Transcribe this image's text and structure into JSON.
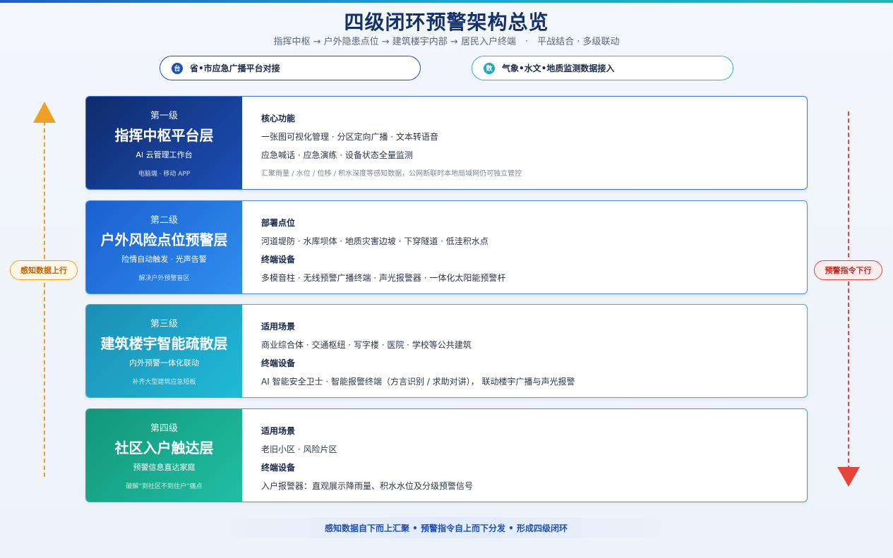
{
  "header": {
    "title": "四级闭环预警架构总览",
    "subtitle": "指挥中枢 → 户外隐患点位 → 建筑楼宇内部 → 居民入户终端　·　平战结合 · 多级联动"
  },
  "pills": {
    "left": {
      "badge": "台",
      "label": "省•市应急广播平台对接"
    },
    "right": {
      "badge": "数",
      "label": "气象•水文•地质监测数据接入"
    }
  },
  "side": {
    "up_label": "感知数据上行",
    "down_label": "预警指令下行"
  },
  "levels": [
    {
      "num": "第一级",
      "name": "指挥中枢平台层",
      "desc": "AI 云管理工作台",
      "note": "电脑端 · 移动 APP",
      "s1_title": "核心功能",
      "s1_line1": "一张图可视化管理 · 分区定向广播 · 文本转语音",
      "s1_line2": "应急喊话 · 应急演练 · 设备状态全量监测",
      "note_line": "汇聚雨量 / 水位 / 位移 / 积水深度等感知数据，公网断联时本地局域网仍可独立管控"
    },
    {
      "num": "第二级",
      "name": "户外风险点位预警层",
      "desc": "险情自动触发 · 光声告警",
      "note": "解决户外预警盲区",
      "s1_title": "部署点位",
      "s1_line1": "河道堤防 · 水库坝体 · 地质灾害边坡 · 下穿隧道 · 低洼积水点",
      "s2_title": "终端设备",
      "s2_line1": "多模音柱 · 无线预警广播终端 · 声光报警器 · 一体化太阳能预警杆"
    },
    {
      "num": "第三级",
      "name": "建筑楼宇智能疏散层",
      "desc": "内外预警一体化联动",
      "note": "补齐大型建筑应急短板",
      "s1_title": "适用场景",
      "s1_line1": "商业综合体 · 交通枢纽 · 写字楼 · 医院 · 学校等公共建筑",
      "s2_title": "终端设备",
      "s2_line1": "AI 智能安全卫士 · 智能报警终端（方言识别 / 求助对讲）， 联动楼宇广播与声光报警"
    },
    {
      "num": "第四级",
      "name": "社区入户触达层",
      "desc": "预警信息直达家庭",
      "note": "破解“到社区不到住户”痛点",
      "s1_title": "适用场景",
      "s1_line1": "老旧小区 · 风险片区",
      "s2_title": "终端设备",
      "s2_line1": "入户报警器：直观展示降雨量、积水水位及分级预警信号"
    }
  ],
  "footer": {
    "text": "感知数据自下而上汇聚 • 预警指令自上而下分发 • 形成四级闭环"
  },
  "colors": {
    "up_arrow": "#f0a024",
    "down_arrow": "#e3453d",
    "level1": "#1c4fb8",
    "level2": "#2f8fee",
    "level3": "#1fbad7",
    "level4": "#1fbfa5"
  }
}
